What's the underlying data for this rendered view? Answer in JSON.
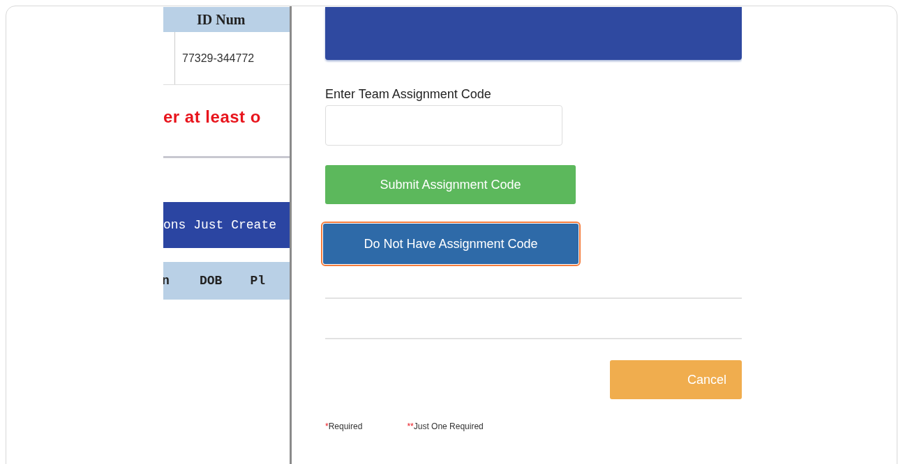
{
  "left_panel": {
    "id_header": "ID Num",
    "id_value": "77329-344772",
    "warning": "er at least o",
    "banner": "ons Just Create",
    "columns": [
      "n",
      "DOB",
      "Pl"
    ]
  },
  "right_panel": {
    "code_label": "Enter Team Assignment Code",
    "buttons": [
      {
        "kind": "submit",
        "label": "Submit Assignment Code",
        "focused": false
      },
      {
        "kind": "primary",
        "label": "Do Not Have Assignment Code",
        "focused": true
      }
    ],
    "cancel": "Cancel",
    "legend": [
      {
        "marker": "*",
        "label": "Required"
      },
      {
        "marker": "**",
        "label": "Just One Required"
      }
    ]
  }
}
